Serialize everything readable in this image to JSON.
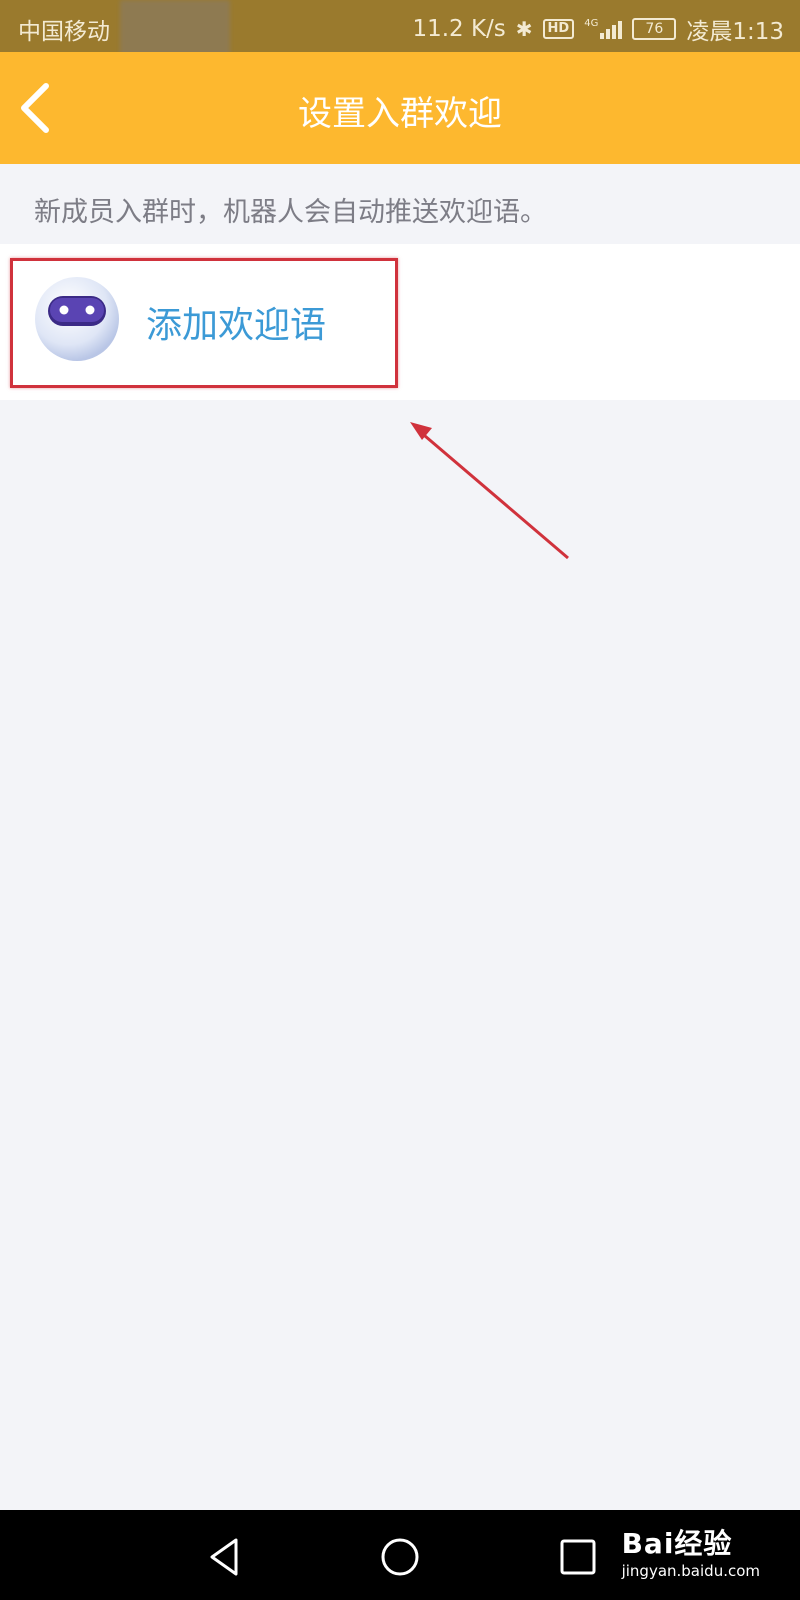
{
  "status_bar": {
    "carrier": "中国移动",
    "net_speed": "11.2 K/s",
    "hd_label": "HD",
    "network_type": "4G",
    "battery": "76",
    "time": "凌晨1:13"
  },
  "title_bar": {
    "title": "设置入群欢迎"
  },
  "description": "新成员入群时，机器人会自动推送欢迎语。",
  "welcome_item": {
    "label": "添加欢迎语"
  },
  "watermark": {
    "main": "Bai经验",
    "sub": "jingyan.baidu.com"
  },
  "colors": {
    "header": "#fdb82f",
    "status_bar": "#9a7a2d",
    "link_text": "#3c9ad6",
    "annotation": "#d0323c",
    "background": "#f3f4f8"
  }
}
